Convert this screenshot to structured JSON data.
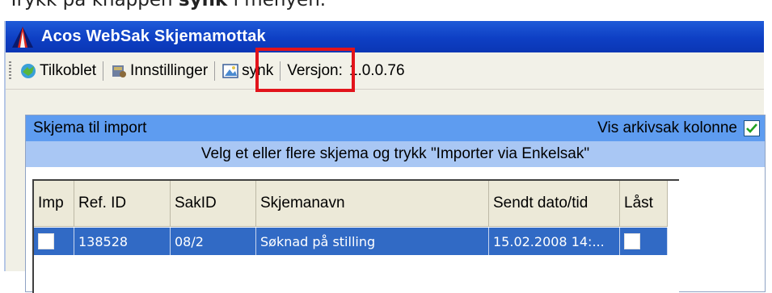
{
  "document": {
    "instruction_prefix": "Trykk på knappen ",
    "instruction_bold": "synk",
    "instruction_suffix": " i menyen."
  },
  "window": {
    "title": "Acos WebSak Skjemamottak"
  },
  "toolbar": {
    "items": [
      {
        "label": "Tilkoblet",
        "icon": "connected-icon"
      },
      {
        "label": "Innstillinger",
        "icon": "settings-icon"
      },
      {
        "label": "synk",
        "icon": "sync-icon"
      }
    ],
    "version_label": "Versjon:",
    "version_value": "1.0.0.76"
  },
  "highlight_color": "#e2141b",
  "panel": {
    "title": "Skjema til import",
    "vis_arkivsak_label": "Vis arkivsak kolonne",
    "vis_arkivsak_checked": true,
    "instruction": "Velg et eller flere skjema og trykk \"Importer via Enkelsak\""
  },
  "grid": {
    "columns": [
      "Imp",
      "Ref. ID",
      "SakID",
      "Skjemanavn",
      "Sendt dato/tid",
      "Låst"
    ],
    "rows": [
      {
        "imp": false,
        "ref_id": "138528",
        "sak_id": "08/2",
        "skjemanavn": "Søknad på stilling",
        "sendt": "15.02.2008 14:...",
        "laast": false
      }
    ]
  },
  "colors": {
    "titlebar": "#0e3fc4",
    "panel_header": "#5e9cf0",
    "instruction_bar": "#a9c7f4",
    "selected_row": "#316ac5"
  }
}
